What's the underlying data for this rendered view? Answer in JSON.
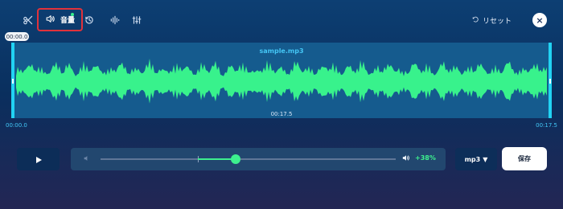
{
  "toolbar": {
    "tools": [
      {
        "icon": "scissors-icon"
      },
      {
        "icon": "volume-icon",
        "label": "音量",
        "active": true
      },
      {
        "icon": "speed-icon"
      },
      {
        "icon": "equalizer-icon"
      },
      {
        "icon": "mixer-icon"
      }
    ],
    "reset_label": "リセット",
    "reset_icon": "undo-icon",
    "close_icon": "close-icon"
  },
  "editor": {
    "cursor_time": "00:00.0",
    "file_name": "sample.mp3",
    "midpoint_time": "00:17.5",
    "start_time": "00:00.0",
    "end_time": "00:17.5"
  },
  "playback": {
    "play_icon": "play-icon",
    "volume_low_icon": "volume-low-icon",
    "volume_high_icon": "volume-high-icon",
    "volume_change": "+38%",
    "volume_level": 0.47
  },
  "export": {
    "format": "mp3",
    "save_label": "保存"
  },
  "colors": {
    "accent": "#3df08e",
    "background_top": "#0d3f73",
    "background_bottom": "#232654",
    "handle": "#21d3f3",
    "alert_border": "#e0323b"
  }
}
